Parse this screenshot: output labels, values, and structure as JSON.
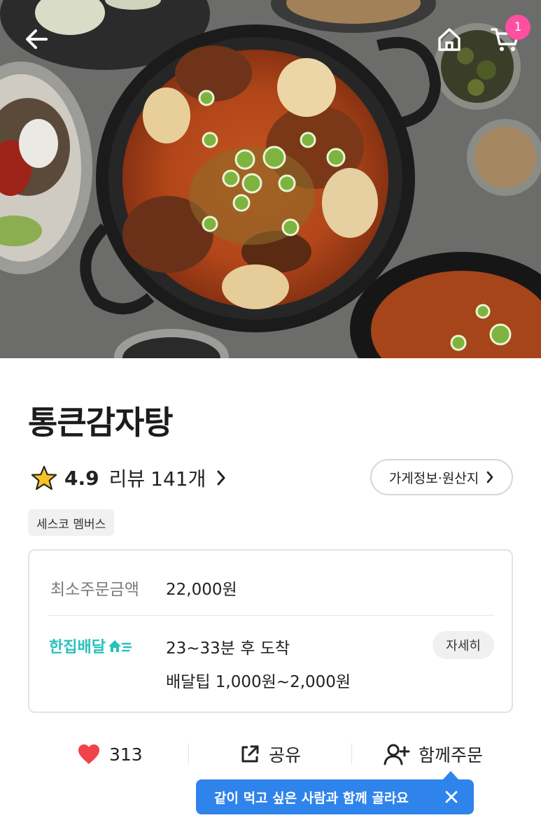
{
  "store": {
    "name": "통큰감자탕",
    "rating": "4.9",
    "review_label": "리뷰",
    "review_count": "141개",
    "info_button": "가게정보·원산지",
    "member_tag": "세스코 멤버스"
  },
  "header": {
    "cart_count": "1"
  },
  "order_info": {
    "min_order_label": "최소주문금액",
    "min_order_value": "22,000원",
    "delivery_type": "한집배달",
    "delivery_time": "23~33분 후 도착",
    "delivery_tip": "배달팁 1,000원~2,000원",
    "detail_button": "자세히"
  },
  "actions": {
    "like_count": "313",
    "share_label": "공유",
    "together_label": "함께주문"
  },
  "tooltip": {
    "text": "같이 먹고 싶은 사람과 함께 골라요"
  },
  "colors": {
    "accent_mint": "#2ac1bc",
    "tooltip_blue": "#2f84ec",
    "heart_red": "#f0434a",
    "badge_pink": "#ff4fa0",
    "star_yellow": "#f7c325"
  },
  "icons": [
    "back-arrow-icon",
    "home-icon",
    "cart-icon",
    "star-icon",
    "chevron-right-icon",
    "heart-icon",
    "share-icon",
    "add-person-icon",
    "close-icon",
    "delivery-house-icon"
  ]
}
